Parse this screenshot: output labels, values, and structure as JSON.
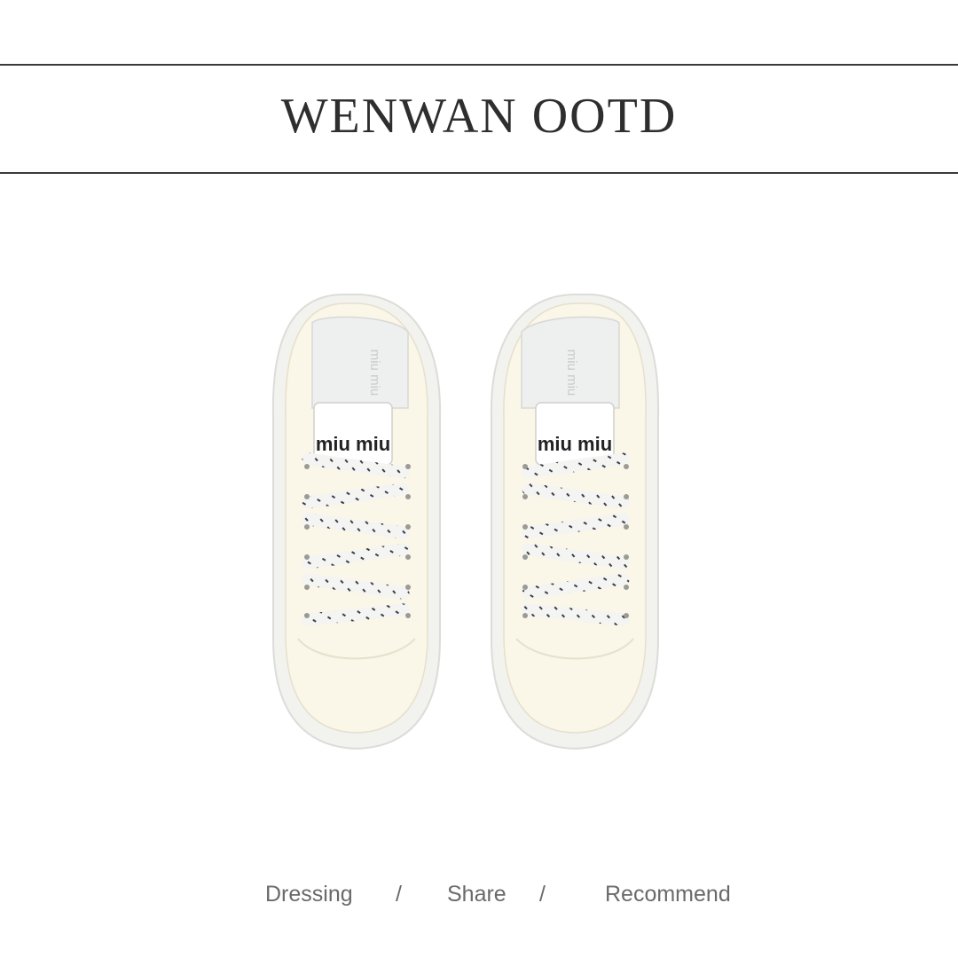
{
  "header": {
    "title": "WENWAN OOTD"
  },
  "image": {
    "subject": "sneaker-mules",
    "logo_text": "miu miu"
  },
  "nav": {
    "items": [
      "Dressing",
      "Share",
      "Recommend"
    ],
    "separator": "/"
  },
  "colors": {
    "canvas": "#FAF6E8",
    "lace_stripe": "#3a3f4a",
    "text": "#2e2e2e",
    "nav_text": "#6a6a6a"
  }
}
